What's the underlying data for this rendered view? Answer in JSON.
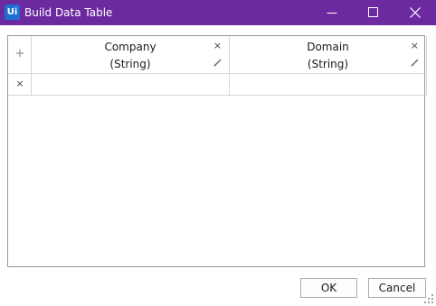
{
  "window": {
    "app_icon_text": "Ui",
    "title": "Build Data Table"
  },
  "table": {
    "add_column_symbol": "+",
    "delete_row_symbol": "×",
    "columns": [
      {
        "name": "Company",
        "type": "(String)"
      },
      {
        "name": "Domain",
        "type": "(String)"
      }
    ],
    "rows": [
      [
        "",
        ""
      ]
    ]
  },
  "buttons": {
    "ok": "OK",
    "cancel": "Cancel"
  },
  "colors": {
    "titlebar": "#6c2aa0",
    "app_icon": "#1f6fd1"
  }
}
